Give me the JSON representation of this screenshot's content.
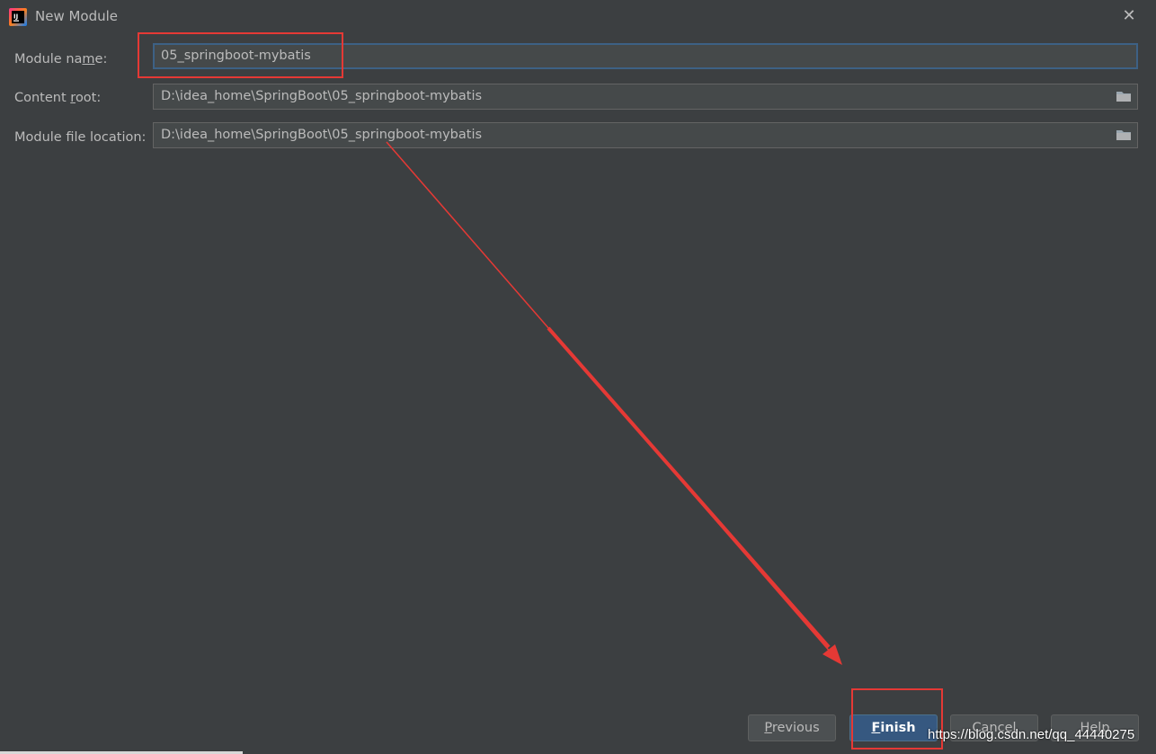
{
  "window": {
    "title": "New Module",
    "app_icon": "intellij-idea-icon",
    "close_icon": "close-icon",
    "close_glyph": "✕"
  },
  "form": {
    "module_name": {
      "label_pre": "Module na",
      "label_mnemonic": "m",
      "label_post": "e:",
      "value": "05_springboot-mybatis"
    },
    "content_root": {
      "label_pre": "Content ",
      "label_mnemonic": "r",
      "label_post": "oot:",
      "value": "D:\\idea_home\\SpringBoot\\05_springboot-mybatis",
      "browse_icon": "folder-icon"
    },
    "module_file_location": {
      "label": "Module file location:",
      "value": "D:\\idea_home\\SpringBoot\\05_springboot-mybatis",
      "browse_icon": "folder-icon"
    }
  },
  "buttons": {
    "previous": {
      "mnemonic": "P",
      "rest": "revious"
    },
    "finish": {
      "mnemonic": "F",
      "rest": "inish"
    },
    "cancel": {
      "label": "Cancel"
    },
    "help": {
      "label": "Help"
    }
  },
  "annotations": {
    "color": "#e53935",
    "watermark": "https://blog.csdn.net/qq_44440275"
  },
  "colors": {
    "background": "#3c3f41",
    "field_background": "#45494a",
    "focus_border": "#3d6185",
    "primary_button": "#365880",
    "text": "#bbbbbb"
  }
}
